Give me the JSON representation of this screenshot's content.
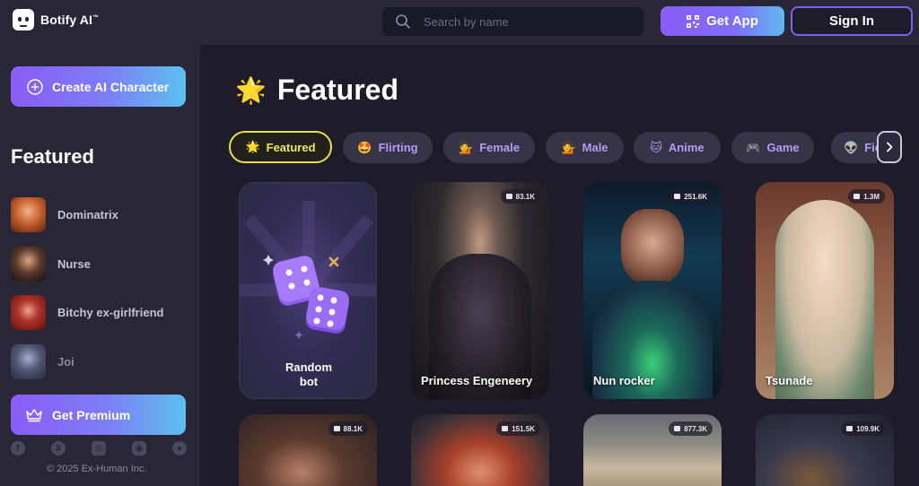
{
  "app": {
    "name": "Botify AI",
    "tm": "™"
  },
  "header": {
    "search_placeholder": "Search by name",
    "get_app_label": "Get App",
    "sign_in_label": "Sign In"
  },
  "sidebar": {
    "create_label": "Create AI Character",
    "section_title": "Featured",
    "items": [
      {
        "label": "Dominatrix"
      },
      {
        "label": "Nurse"
      },
      {
        "label": "Bitchy ex-girlfriend"
      },
      {
        "label": "Joi"
      }
    ],
    "premium_label": "Get Premium",
    "socials": [
      "facebook-icon",
      "x-icon",
      "instagram-icon",
      "discord-icon",
      "reddit-icon"
    ],
    "copyright": "© 2025 Ex-Human Inc."
  },
  "main": {
    "title_emoji": "🌟",
    "title": "Featured",
    "chips": [
      {
        "emoji": "🌟",
        "label": "Featured",
        "active": true
      },
      {
        "emoji": "🤩",
        "label": "Flirting"
      },
      {
        "emoji": "💁",
        "label": "Female"
      },
      {
        "emoji": "💁",
        "label": "Male"
      },
      {
        "emoji": "🐱",
        "label": "Anime"
      },
      {
        "emoji": "🎮",
        "label": "Game"
      },
      {
        "emoji": "👽",
        "label": "Fic"
      }
    ],
    "cards": [
      {
        "name": "Random bot",
        "name_line1": "Random",
        "name_line2": "bot",
        "type": "random"
      },
      {
        "name": "Princess Engeneery",
        "count": "83.1K"
      },
      {
        "name": "Nun rocker",
        "count": "251.6K"
      },
      {
        "name": "Tsunade",
        "count": "1.3M"
      },
      {
        "name": "",
        "count": "88.1K"
      },
      {
        "name": "",
        "count": "151.5K"
      },
      {
        "name": "",
        "count": "877.3K"
      },
      {
        "name": "",
        "count": "109.9K"
      }
    ]
  },
  "colors": {
    "background": "#1e1c2b",
    "panel": "#282637",
    "accent_purple": "#8a5cf6",
    "accent_blue": "#5cc0ef",
    "chip_text": "#b69cf7",
    "active_chip": "#e8e04e"
  }
}
